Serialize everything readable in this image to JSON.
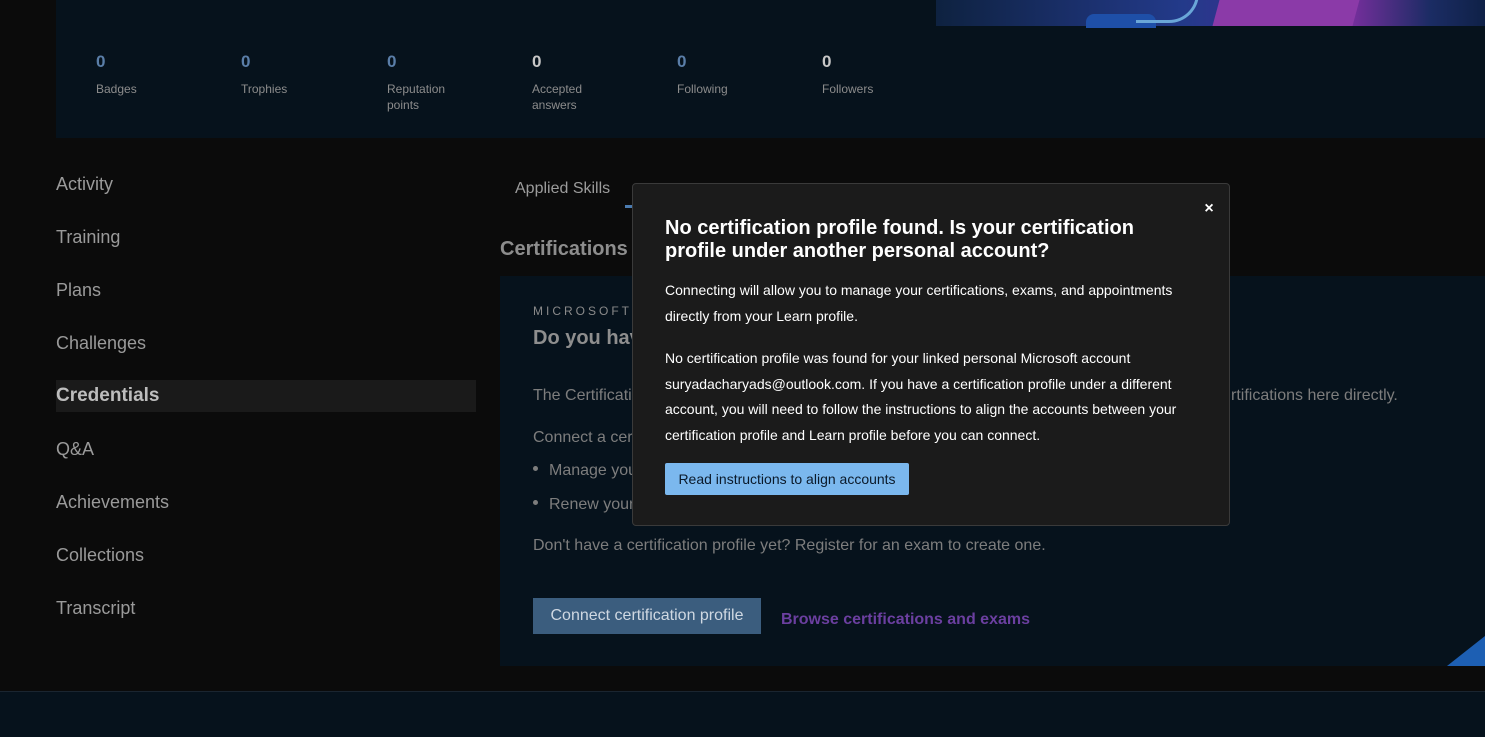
{
  "stats": [
    {
      "value": "0",
      "label_lines": [
        "Badges"
      ]
    },
    {
      "value": "0",
      "label_lines": [
        "Trophies"
      ]
    },
    {
      "value": "0",
      "label_lines": [
        "Reputation",
        "points"
      ]
    },
    {
      "value": "0",
      "label_lines": [
        "Accepted",
        "answers"
      ]
    },
    {
      "value": "0",
      "label_lines": [
        "Following"
      ]
    },
    {
      "value": "0",
      "label_lines": [
        "Followers"
      ]
    }
  ],
  "nav": {
    "items": [
      "Activity",
      "Training",
      "Plans",
      "Challenges",
      "Credentials",
      "Q&A",
      "Achievements",
      "Collections",
      "Transcript"
    ],
    "active": "Credentials"
  },
  "tabs": {
    "applied_skills": "Applied Skills"
  },
  "section_title": "Certifications",
  "card": {
    "eyebrow": "MICROSOFT",
    "heading": "Do you hav",
    "text1": "The Certificati",
    "text1_tail": "rtifications here directly.",
    "text2": "Connect a cert",
    "bullet1": "Manage you",
    "bullet2": "Renew your",
    "register_text": "Don't have a certification profile yet? Register for an exam to create one.",
    "connect_button": "Connect certification profile",
    "browse_link": "Browse certifications and exams"
  },
  "modal": {
    "close_symbol": "×",
    "title": "No certification profile found. Is your certification profile under another personal account?",
    "paragraph1": "Connecting will allow you to manage your certifications, exams, and appointments directly from your Learn profile.",
    "paragraph2": "No certification profile was found for your linked personal Microsoft account suryadacharyads@outlook.com. If you have a certification profile under a different account, you will need to follow the instructions to align the accounts between your certification profile and Learn profile before you can connect.",
    "button": "Read instructions to align accounts"
  },
  "colors": {
    "stat_number": "#5a7ea8",
    "modal_button": "#7bb8ee",
    "browse_link": "#6b3fa0"
  }
}
